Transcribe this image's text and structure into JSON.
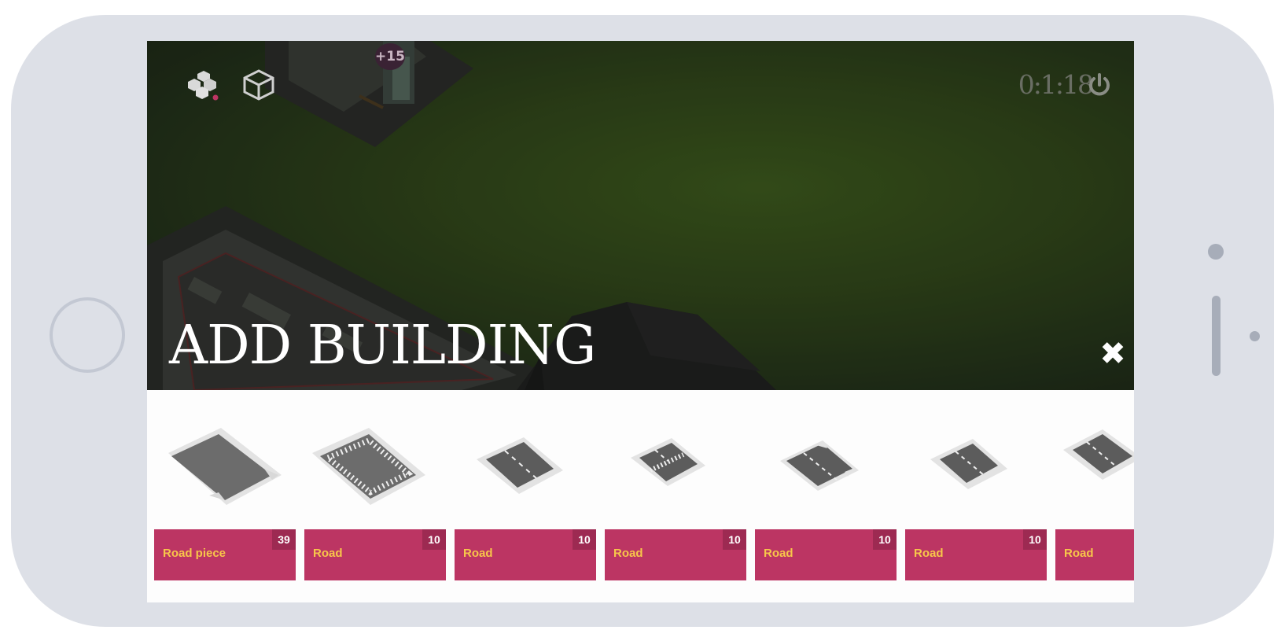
{
  "hud": {
    "score_badge": "+15",
    "timer": "0:1:18",
    "icons": [
      "city-icon",
      "cube-icon",
      "power-icon"
    ]
  },
  "panel": {
    "title": "ADD BUILDING",
    "close_icon": "close-icon"
  },
  "cards": [
    {
      "name": "Road piece",
      "count": "39",
      "variant": "plain"
    },
    {
      "name": "Road",
      "count": "10",
      "variant": "crosswalk-square"
    },
    {
      "name": "Road",
      "count": "10",
      "variant": "straight"
    },
    {
      "name": "Road",
      "count": "10",
      "variant": "crosswalk"
    },
    {
      "name": "Road",
      "count": "10",
      "variant": "corner"
    },
    {
      "name": "Road",
      "count": "10",
      "variant": "straight-wide"
    },
    {
      "name": "Road",
      "count": "",
      "variant": "partial"
    }
  ],
  "colors": {
    "card_label": "#bc3563",
    "card_text": "#f7c64a",
    "count_badge": "#9d2a52",
    "scene": "#30451a"
  }
}
